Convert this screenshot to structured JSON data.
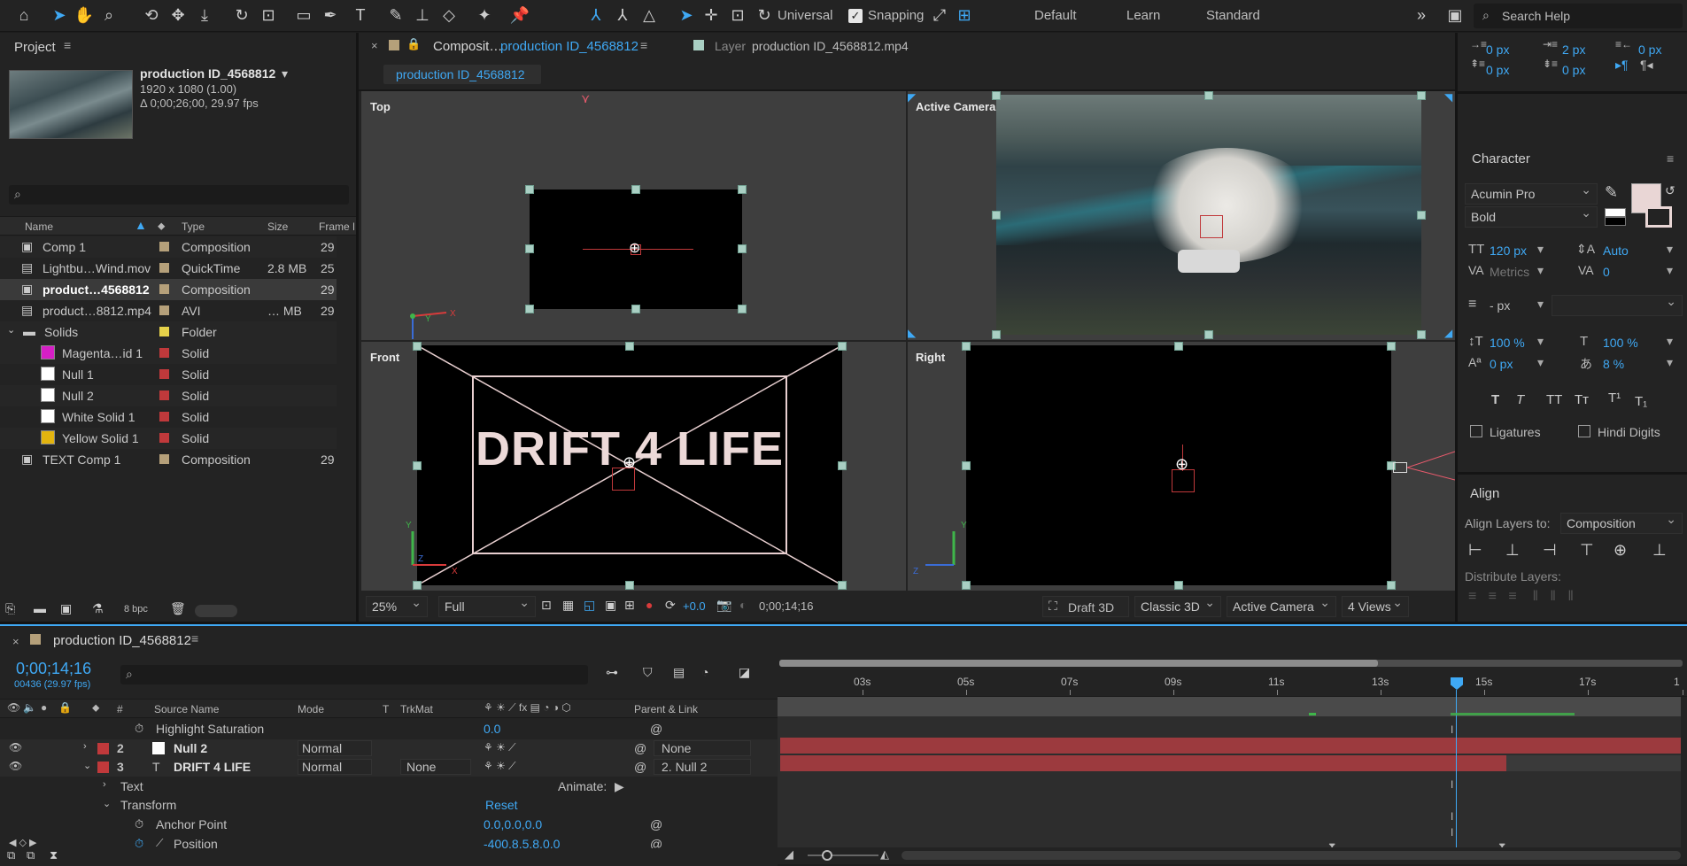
{
  "toolbar": {
    "universal": "Universal",
    "snapping": "Snapping",
    "workspaces": [
      "Default",
      "Learn",
      "Standard"
    ],
    "search_placeholder": "Search Help"
  },
  "project": {
    "tab": "Project",
    "comp_name": "production ID_4568812",
    "comp_res": "1920 x 1080 (1.00)",
    "comp_dur": "Δ 0;00;26;00, 29.97 fps",
    "columns": {
      "name": "Name",
      "type": "Type",
      "size": "Size",
      "frame": "Frame R"
    },
    "items": [
      {
        "name": "Comp 1",
        "type": "Composition",
        "size": "",
        "fr": "29",
        "label": "#b5a07a",
        "kind": "comp"
      },
      {
        "name": "Lightbu…Wind.mov",
        "type": "QuickTime",
        "size": "2.8 MB",
        "fr": "25",
        "label": "#b5a07a",
        "kind": "file"
      },
      {
        "name": "product…4568812",
        "type": "Composition",
        "size": "",
        "fr": "29",
        "label": "#b5a07a",
        "kind": "comp"
      },
      {
        "name": "product…8812.mp4",
        "type": "AVI",
        "size": "… MB",
        "fr": "29",
        "label": "#b5a07a",
        "kind": "file"
      },
      {
        "name": "Solids",
        "type": "Folder",
        "size": "",
        "fr": "",
        "label": "#e6d24a",
        "kind": "folder"
      },
      {
        "name": "Magenta…id 1",
        "type": "Solid",
        "size": "",
        "fr": "",
        "label": "#c0393b",
        "kind": "solid",
        "swatch": "#d61fc6"
      },
      {
        "name": "Null 1",
        "type": "Solid",
        "size": "",
        "fr": "",
        "label": "#c0393b",
        "kind": "solid",
        "swatch": "#ffffff"
      },
      {
        "name": "Null 2",
        "type": "Solid",
        "size": "",
        "fr": "",
        "label": "#c0393b",
        "kind": "solid",
        "swatch": "#ffffff"
      },
      {
        "name": "White Solid 1",
        "type": "Solid",
        "size": "",
        "fr": "",
        "label": "#c0393b",
        "kind": "solid",
        "swatch": "#ffffff"
      },
      {
        "name": "Yellow Solid 1",
        "type": "Solid",
        "size": "",
        "fr": "",
        "label": "#c0393b",
        "kind": "solid",
        "swatch": "#e3b40f"
      },
      {
        "name": "TEXT Comp 1",
        "type": "Composition",
        "size": "",
        "fr": "29",
        "label": "#b5a07a",
        "kind": "comp"
      }
    ],
    "bpc": "8 bpc"
  },
  "comp": {
    "tab_prefix": "Composit…",
    "tab_name": "production ID_4568812",
    "layer_tab_prefix": "Layer",
    "layer_tab_name": "production ID_4568812.mp4",
    "breadcrumb": "production ID_4568812",
    "views": {
      "top": "Top",
      "active": "Active Camera",
      "front": "Front",
      "right": "Right"
    },
    "text": "DRIFT 4 LIFE",
    "footer": {
      "zoom": "25%",
      "resolution": "Full",
      "exposure": "+0.0",
      "timecode": "0;00;14;16",
      "draft": "Draft 3D",
      "renderer": "Classic 3D",
      "camera": "Active Camera",
      "views": "4 Views"
    }
  },
  "character": {
    "spacing": {
      "a": "0 px",
      "b": "2 px",
      "c": "0 px",
      "d": "0 px",
      "e": "0 px"
    },
    "title": "Character",
    "font": "Acumin Pro",
    "style": "Bold",
    "size": "120 px",
    "leading": "Auto",
    "kerning": "Metrics",
    "tracking": "0",
    "stroke": "- px",
    "vscale": "100 %",
    "hscale": "100 %",
    "baseline": "0 px",
    "tsume": "8 %",
    "ligatures": "Ligatures",
    "hindi": "Hindi Digits",
    "fill": "#e9d6d5"
  },
  "align": {
    "title": "Align",
    "layers_to_label": "Align Layers to:",
    "layers_to": "Composition",
    "distribute": "Distribute Layers:"
  },
  "timeline": {
    "tab": "production ID_4568812",
    "timecode": "0;00;14;16",
    "frames": "00436 (29.97 fps)",
    "columns": {
      "source": "Source Name",
      "mode": "Mode",
      "t": "T",
      "trkmat": "TrkMat",
      "parent": "Parent & Link"
    },
    "ruler": [
      "03s",
      "05s",
      "07s",
      "09s",
      "11s",
      "13s",
      "15s",
      "17s",
      "1"
    ],
    "rows": [
      {
        "kind": "prop",
        "name": "Highlight Saturation",
        "value": "0.0"
      },
      {
        "kind": "layer",
        "num": "2",
        "name": "Null 2",
        "mode": "Normal",
        "trkmat": "",
        "parent": "None"
      },
      {
        "kind": "layer",
        "num": "3",
        "name": "DRIFT 4 LIFE",
        "mode": "Normal",
        "trkmat": "None",
        "parent": "2. Null 2"
      },
      {
        "kind": "group",
        "name": "Text",
        "animate": "Animate:"
      },
      {
        "kind": "group",
        "name": "Transform",
        "value": "Reset"
      },
      {
        "kind": "prop",
        "name": "Anchor Point",
        "value": "0.0,0.0,0.0"
      },
      {
        "kind": "prop",
        "name": "Position",
        "value": "-400.8,5.8,0.0"
      }
    ]
  }
}
